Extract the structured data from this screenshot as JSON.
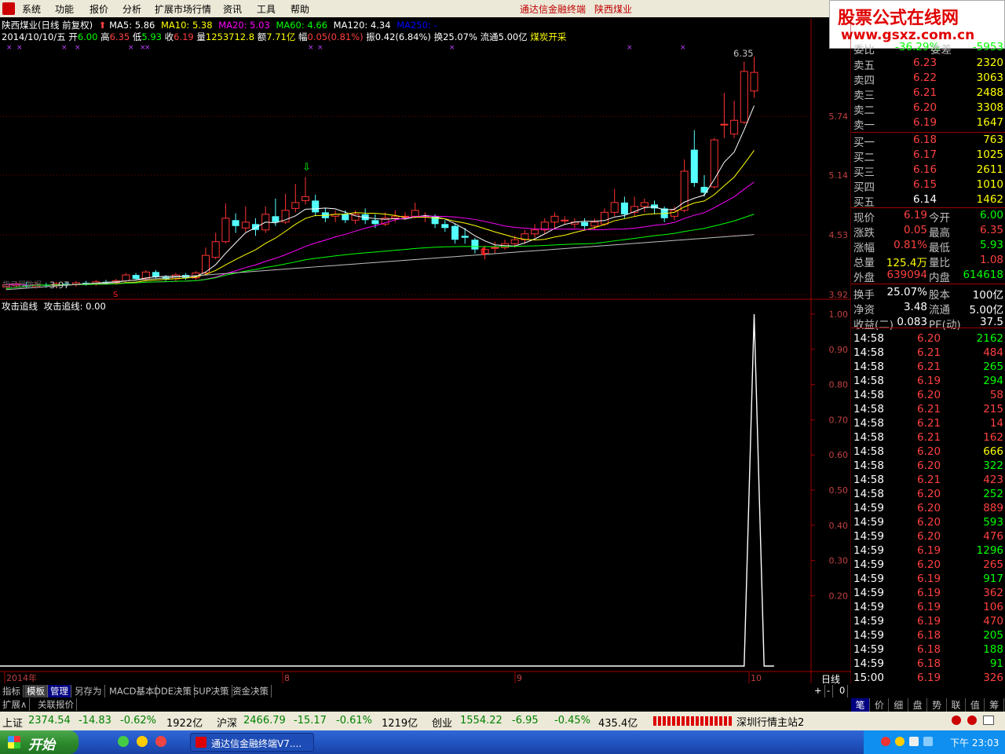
{
  "menu": [
    "系统",
    "功能",
    "报价",
    "分析",
    "扩展市场行情",
    "资讯",
    "工具",
    "帮助"
  ],
  "terminal_title": "通达信金融终端",
  "terminal_stock": "陕西煤业",
  "watermark": {
    "title": "股票公式在线网",
    "url": "www.gsxz.com.cn"
  },
  "chart_header": {
    "name": "陕西煤业(日线 前复权)",
    "ma5": "MA5: 5.86",
    "ma10": "MA10: 5.38",
    "ma20": "MA20: 5.03",
    "ma60": "MA60: 4.66",
    "ma120": "MA120: 4.34",
    "ma250": "MA250: -",
    "date": "2014/10/10/五",
    "open_lbl": "开",
    "open": "6.00",
    "high_lbl": "高",
    "high": "6.35",
    "low_lbl": "低",
    "low": "5.93",
    "close_lbl": "收",
    "close": "6.19",
    "vol_lbl": "量",
    "vol": "1253712.8",
    "amt_lbl": "额",
    "amt": "7.71亿",
    "amp_lbl": "幅",
    "amp": "0.05(0.81%)",
    "swing": "振0.42(6.84%)",
    "turnover": "换25.07%",
    "float": "流通5.00亿",
    "industry": "煤炭开采",
    "max_label": "6.35",
    "min_label": "3.97",
    "hint_label": "指示器数据"
  },
  "indicator": {
    "name": "攻击追线",
    "value_label": "攻击追线: 0.00"
  },
  "chart_data": [
    {
      "type": "candlestick",
      "title": "陕西煤业(日线 前复权)",
      "y_axis_ticks": [
        5.74,
        5.14,
        4.53,
        3.92
      ],
      "x_ticks": [
        "2014年",
        "8",
        "9",
        "10"
      ],
      "candles": [
        {
          "o": 4.0,
          "c": 4.02,
          "h": 4.04,
          "l": 3.97
        },
        {
          "o": 4.01,
          "c": 4.03,
          "h": 4.05,
          "l": 3.99
        },
        {
          "o": 4.02,
          "c": 4.0,
          "h": 4.05,
          "l": 3.98
        },
        {
          "o": 4.0,
          "c": 4.02,
          "h": 4.04,
          "l": 3.98
        },
        {
          "o": 4.02,
          "c": 4.01,
          "h": 4.04,
          "l": 3.99
        },
        {
          "o": 4.01,
          "c": 4.03,
          "h": 4.05,
          "l": 3.99
        },
        {
          "o": 4.03,
          "c": 4.02,
          "h": 4.05,
          "l": 4.0
        },
        {
          "o": 4.02,
          "c": 4.04,
          "h": 4.06,
          "l": 4.0
        },
        {
          "o": 4.04,
          "c": 4.03,
          "h": 4.06,
          "l": 4.01
        },
        {
          "o": 4.03,
          "c": 4.05,
          "h": 4.07,
          "l": 4.01
        },
        {
          "o": 4.05,
          "c": 4.04,
          "h": 4.07,
          "l": 4.02
        },
        {
          "o": 4.04,
          "c": 4.06,
          "h": 4.08,
          "l": 4.02
        },
        {
          "o": 4.06,
          "c": 4.12,
          "h": 4.14,
          "l": 4.04
        },
        {
          "o": 4.12,
          "c": 4.08,
          "h": 4.14,
          "l": 4.06
        },
        {
          "o": 4.08,
          "c": 4.15,
          "h": 4.17,
          "l": 4.06
        },
        {
          "o": 4.15,
          "c": 4.1,
          "h": 4.17,
          "l": 4.08
        },
        {
          "o": 4.1,
          "c": 4.08,
          "h": 4.12,
          "l": 4.06
        },
        {
          "o": 4.08,
          "c": 4.12,
          "h": 4.14,
          "l": 4.06
        },
        {
          "o": 4.12,
          "c": 4.09,
          "h": 4.14,
          "l": 4.07
        },
        {
          "o": 4.09,
          "c": 4.14,
          "h": 4.16,
          "l": 4.07
        },
        {
          "o": 4.14,
          "c": 4.32,
          "h": 4.4,
          "l": 4.12
        },
        {
          "o": 4.3,
          "c": 4.46,
          "h": 4.55,
          "l": 4.28
        },
        {
          "o": 4.46,
          "c": 4.7,
          "h": 4.85,
          "l": 4.44
        },
        {
          "o": 4.68,
          "c": 4.62,
          "h": 4.75,
          "l": 4.55
        },
        {
          "o": 4.6,
          "c": 4.66,
          "h": 4.82,
          "l": 4.56
        },
        {
          "o": 4.64,
          "c": 4.58,
          "h": 4.7,
          "l": 4.52
        },
        {
          "o": 4.58,
          "c": 4.74,
          "h": 4.82,
          "l": 4.55
        },
        {
          "o": 4.72,
          "c": 4.66,
          "h": 4.9,
          "l": 4.62
        },
        {
          "o": 4.66,
          "c": 4.78,
          "h": 4.95,
          "l": 4.64
        },
        {
          "o": 4.8,
          "c": 4.86,
          "h": 5.05,
          "l": 4.76
        },
        {
          "o": 4.88,
          "c": 4.92,
          "h": 5.12,
          "l": 4.84
        },
        {
          "o": 4.88,
          "c": 4.76,
          "h": 4.94,
          "l": 4.72
        },
        {
          "o": 4.76,
          "c": 4.7,
          "h": 4.8,
          "l": 4.66
        },
        {
          "o": 4.72,
          "c": 4.74,
          "h": 4.78,
          "l": 4.66
        },
        {
          "o": 4.74,
          "c": 4.68,
          "h": 4.78,
          "l": 4.65
        },
        {
          "o": 4.68,
          "c": 4.74,
          "h": 4.78,
          "l": 4.64
        },
        {
          "o": 4.74,
          "c": 4.68,
          "h": 4.8,
          "l": 4.64
        },
        {
          "o": 4.68,
          "c": 4.64,
          "h": 4.74,
          "l": 4.6
        },
        {
          "o": 4.64,
          "c": 4.7,
          "h": 4.76,
          "l": 4.62
        },
        {
          "o": 4.7,
          "c": 4.72,
          "h": 4.78,
          "l": 4.66
        },
        {
          "o": 4.72,
          "c": 4.72,
          "h": 4.76,
          "l": 4.68
        },
        {
          "o": 4.72,
          "c": 4.78,
          "h": 4.86,
          "l": 4.7
        },
        {
          "o": 4.72,
          "c": 4.72,
          "h": 4.76,
          "l": 4.66
        },
        {
          "o": 4.72,
          "c": 4.64,
          "h": 4.74,
          "l": 4.6
        },
        {
          "o": 4.64,
          "c": 4.6,
          "h": 4.68,
          "l": 4.56
        },
        {
          "o": 4.62,
          "c": 4.48,
          "h": 4.64,
          "l": 4.44
        },
        {
          "o": 4.52,
          "c": 4.5,
          "h": 4.6,
          "l": 4.44
        },
        {
          "o": 4.48,
          "c": 4.38,
          "h": 4.5,
          "l": 4.34
        },
        {
          "o": 4.34,
          "c": 4.38,
          "h": 4.42,
          "l": 4.28
        },
        {
          "o": 4.4,
          "c": 4.4,
          "h": 4.46,
          "l": 4.34
        },
        {
          "o": 4.4,
          "c": 4.44,
          "h": 4.48,
          "l": 4.38
        },
        {
          "o": 4.44,
          "c": 4.48,
          "h": 4.52,
          "l": 4.4
        },
        {
          "o": 4.48,
          "c": 4.54,
          "h": 4.58,
          "l": 4.44
        },
        {
          "o": 4.54,
          "c": 4.58,
          "h": 4.64,
          "l": 4.5
        },
        {
          "o": 4.58,
          "c": 4.66,
          "h": 4.7,
          "l": 4.54
        },
        {
          "o": 4.66,
          "c": 4.72,
          "h": 4.76,
          "l": 4.6
        },
        {
          "o": 4.68,
          "c": 4.68,
          "h": 4.72,
          "l": 4.64
        },
        {
          "o": 4.64,
          "c": 4.66,
          "h": 4.7,
          "l": 4.6
        },
        {
          "o": 4.66,
          "c": 4.62,
          "h": 4.7,
          "l": 4.58
        },
        {
          "o": 4.62,
          "c": 4.66,
          "h": 4.7,
          "l": 4.58
        },
        {
          "o": 4.64,
          "c": 4.76,
          "h": 4.8,
          "l": 4.62
        },
        {
          "o": 4.76,
          "c": 4.86,
          "h": 5.0,
          "l": 4.72
        },
        {
          "o": 4.86,
          "c": 4.74,
          "h": 4.92,
          "l": 4.7
        },
        {
          "o": 4.76,
          "c": 4.82,
          "h": 4.92,
          "l": 4.72
        },
        {
          "o": 4.82,
          "c": 4.86,
          "h": 4.9,
          "l": 4.76
        },
        {
          "o": 4.84,
          "c": 4.8,
          "h": 4.88,
          "l": 4.74
        },
        {
          "o": 4.8,
          "c": 4.7,
          "h": 4.82,
          "l": 4.66
        },
        {
          "o": 4.72,
          "c": 4.78,
          "h": 4.82,
          "l": 4.68
        },
        {
          "o": 4.78,
          "c": 5.18,
          "h": 5.3,
          "l": 4.76
        },
        {
          "o": 5.4,
          "c": 5.06,
          "h": 5.6,
          "l": 5.02
        },
        {
          "o": 5.02,
          "c": 4.96,
          "h": 5.14,
          "l": 4.92
        },
        {
          "o": 5.02,
          "c": 5.5,
          "h": 5.52,
          "l": 5.0
        },
        {
          "o": 5.66,
          "c": 5.66,
          "h": 5.98,
          "l": 5.52
        },
        {
          "o": 5.56,
          "c": 5.7,
          "h": 5.9,
          "l": 5.52
        },
        {
          "o": 5.68,
          "c": 6.2,
          "h": 6.3,
          "l": 5.66
        },
        {
          "o": 6.0,
          "c": 6.19,
          "h": 6.35,
          "l": 5.93
        }
      ],
      "ma_series": [
        {
          "name": "MA5",
          "color": "#ffffff"
        },
        {
          "name": "MA10",
          "color": "#ffff00"
        },
        {
          "name": "MA20",
          "color": "#ff00ff"
        },
        {
          "name": "MA60",
          "color": "#00ff00"
        },
        {
          "name": "MA120",
          "color": "#c0c0c0"
        }
      ]
    },
    {
      "type": "line",
      "title": "攻击追线",
      "y_axis_ticks": [
        1.0,
        0.9,
        0.8,
        0.7,
        0.6,
        0.5,
        0.4,
        0.3,
        0.2
      ],
      "series": [
        {
          "name": "攻击追线",
          "values": [
            0,
            0,
            0,
            0,
            0,
            0,
            0,
            0,
            0,
            0,
            0,
            0,
            0,
            0,
            0,
            0,
            0,
            0,
            0,
            0,
            0,
            0,
            0,
            0,
            0,
            0,
            0,
            0,
            0,
            0,
            0,
            0,
            0,
            0,
            0,
            0,
            0,
            0,
            0,
            0,
            0,
            0,
            0,
            0,
            0,
            0,
            0,
            0,
            0,
            0,
            0,
            0,
            0,
            0,
            0,
            0,
            0,
            0,
            0,
            0,
            0,
            0,
            0,
            0,
            0,
            0,
            0,
            0,
            0,
            0,
            0,
            0,
            0,
            0,
            0,
            1,
            0,
            0
          ]
        }
      ],
      "ylim": [
        0,
        1
      ]
    }
  ],
  "order_book": {
    "header_lbl": "委比",
    "header_val": "-36.29%",
    "header_lbl2": "委差",
    "header_val2": "-5953",
    "asks": [
      {
        "label": "卖五",
        "price": "6.23",
        "vol": "2320"
      },
      {
        "label": "卖四",
        "price": "6.22",
        "vol": "3063"
      },
      {
        "label": "卖三",
        "price": "6.21",
        "vol": "2488"
      },
      {
        "label": "卖二",
        "price": "6.20",
        "vol": "3308"
      },
      {
        "label": "卖一",
        "price": "6.19",
        "vol": "1647"
      }
    ],
    "bids": [
      {
        "label": "买一",
        "price": "6.18",
        "vol": "763"
      },
      {
        "label": "买二",
        "price": "6.17",
        "vol": "1025"
      },
      {
        "label": "买三",
        "price": "6.16",
        "vol": "2611"
      },
      {
        "label": "买四",
        "price": "6.15",
        "vol": "1010"
      },
      {
        "label": "买五",
        "price": "6.14",
        "vol": "1462"
      }
    ]
  },
  "quote": [
    {
      "l1": "现价",
      "v1": "6.19",
      "l2": "今开",
      "v2": "6.00",
      "c1": "red",
      "c2": "grn"
    },
    {
      "l1": "涨跌",
      "v1": "0.05",
      "l2": "最高",
      "v2": "6.35",
      "c1": "red",
      "c2": "red"
    },
    {
      "l1": "涨幅",
      "v1": "0.81%",
      "l2": "最低",
      "v2": "5.93",
      "c1": "red",
      "c2": "grn"
    },
    {
      "l1": "总量",
      "v1": "125.4万",
      "l2": "量比",
      "v2": "1.08",
      "c1": "yel",
      "c2": "red"
    },
    {
      "l1": "外盘",
      "v1": "639094",
      "l2": "内盘",
      "v2": "614618",
      "c1": "red",
      "c2": "grn"
    },
    {
      "l1": "换手",
      "v1": "25.07%",
      "l2": "股本",
      "v2": "100亿",
      "c1": "wht",
      "c2": "wht"
    },
    {
      "l1": "净资",
      "v1": "3.48",
      "l2": "流通",
      "v2": "5.00亿",
      "c1": "wht",
      "c2": "wht"
    },
    {
      "l1": "收益(二)",
      "v1": "0.083",
      "l2": "PE(动)",
      "v2": "37.5",
      "c1": "wht",
      "c2": "wht"
    }
  ],
  "ticks": [
    {
      "t": "14:58",
      "p": "6.20",
      "v": "2162",
      "pc": "red",
      "vc": "grn"
    },
    {
      "t": "14:58",
      "p": "6.21",
      "v": "484",
      "pc": "red",
      "vc": "red"
    },
    {
      "t": "14:58",
      "p": "6.21",
      "v": "265",
      "pc": "red",
      "vc": "grn"
    },
    {
      "t": "14:58",
      "p": "6.19",
      "v": "294",
      "pc": "red",
      "vc": "grn"
    },
    {
      "t": "14:58",
      "p": "6.20",
      "v": "58",
      "pc": "red",
      "vc": "red"
    },
    {
      "t": "14:58",
      "p": "6.21",
      "v": "215",
      "pc": "red",
      "vc": "red"
    },
    {
      "t": "14:58",
      "p": "6.21",
      "v": "14",
      "pc": "red",
      "vc": "red"
    },
    {
      "t": "14:58",
      "p": "6.21",
      "v": "162",
      "pc": "red",
      "vc": "red"
    },
    {
      "t": "14:58",
      "p": "6.20",
      "v": "666",
      "pc": "red",
      "vc": "yel"
    },
    {
      "t": "14:58",
      "p": "6.20",
      "v": "322",
      "pc": "red",
      "vc": "grn"
    },
    {
      "t": "14:58",
      "p": "6.21",
      "v": "423",
      "pc": "red",
      "vc": "red"
    },
    {
      "t": "14:58",
      "p": "6.20",
      "v": "252",
      "pc": "red",
      "vc": "grn"
    },
    {
      "t": "14:59",
      "p": "6.20",
      "v": "889",
      "pc": "red",
      "vc": "red"
    },
    {
      "t": "14:59",
      "p": "6.20",
      "v": "593",
      "pc": "red",
      "vc": "grn"
    },
    {
      "t": "14:59",
      "p": "6.20",
      "v": "476",
      "pc": "red",
      "vc": "red"
    },
    {
      "t": "14:59",
      "p": "6.19",
      "v": "1296",
      "pc": "red",
      "vc": "grn"
    },
    {
      "t": "14:59",
      "p": "6.20",
      "v": "265",
      "pc": "red",
      "vc": "red"
    },
    {
      "t": "14:59",
      "p": "6.19",
      "v": "917",
      "pc": "red",
      "vc": "grn"
    },
    {
      "t": "14:59",
      "p": "6.19",
      "v": "362",
      "pc": "red",
      "vc": "red"
    },
    {
      "t": "14:59",
      "p": "6.19",
      "v": "106",
      "pc": "red",
      "vc": "red"
    },
    {
      "t": "14:59",
      "p": "6.19",
      "v": "470",
      "pc": "red",
      "vc": "red"
    },
    {
      "t": "14:59",
      "p": "6.18",
      "v": "205",
      "pc": "red",
      "vc": "grn"
    },
    {
      "t": "14:59",
      "p": "6.18",
      "v": "188",
      "pc": "red",
      "vc": "grn"
    },
    {
      "t": "14:59",
      "p": "6.18",
      "v": "91",
      "pc": "red",
      "vc": "grn"
    },
    {
      "t": "15:00",
      "p": "6.19",
      "v": "326",
      "pc": "red",
      "vc": "red"
    }
  ],
  "period_label": "日线",
  "tabs": [
    "指标",
    "模板",
    "管理",
    "另存为",
    "MACD基本",
    "DDE决策",
    "SUP决策",
    "资金决策"
  ],
  "ext_tabs": [
    "扩展∧",
    "关联报价"
  ],
  "right_tabs": [
    "笔",
    "价",
    "细",
    "盘",
    "势",
    "联",
    "值",
    "筹"
  ],
  "zoom_controls": [
    "+",
    "-",
    "0"
  ],
  "status": {
    "sh_lbl": "上证",
    "sh": "2374.54",
    "sh_chg": "-14.83",
    "sh_pct": "-0.62%",
    "sh_amt": "1922亿",
    "sz_lbl": "沪深",
    "sz": "2466.79",
    "sz_chg": "-15.17",
    "sz_pct": "-0.61%",
    "sz_amt": "1219亿",
    "cy_lbl": "创业",
    "cy": "1554.22",
    "cy_chg": "-6.95",
    "cy_pct": "-0.45%",
    "cy_amt": "435.4亿",
    "server": "深圳行情主站2"
  },
  "taskbar": {
    "start": "开始",
    "task": "通达信金融终端V7....",
    "clock": "下午 23:03"
  }
}
